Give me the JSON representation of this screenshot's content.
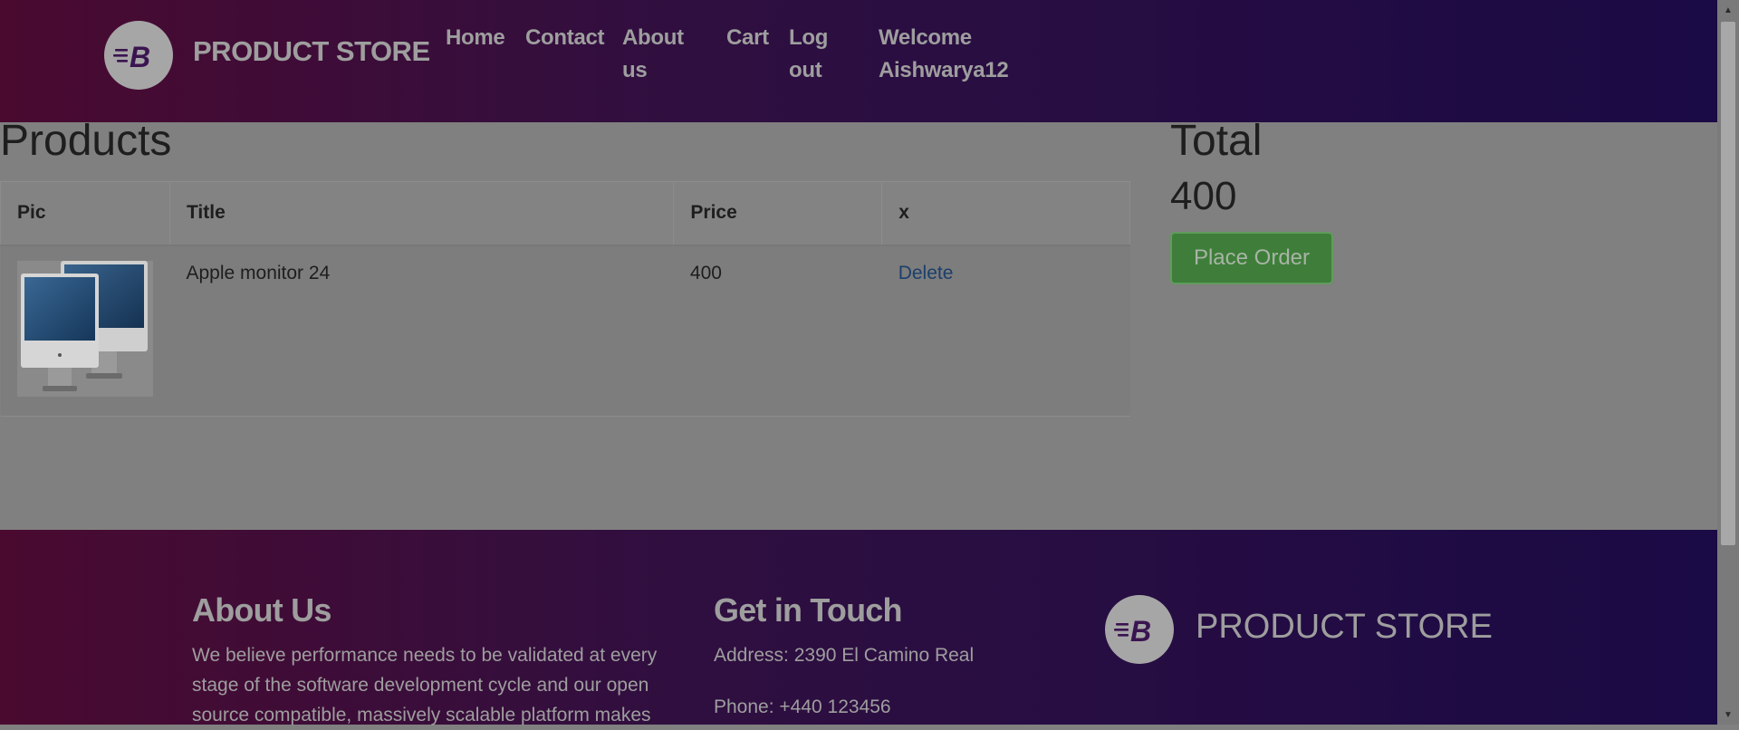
{
  "nav": {
    "brand": "PRODUCT STORE",
    "links": {
      "home": "Home",
      "contact": "Contact",
      "about_line1": "About",
      "about_line2": "us",
      "cart": "Cart",
      "logout_line1": "Log",
      "logout_line2": "out",
      "welcome_line1": "Welcome",
      "welcome_line2": "Aishwarya12"
    }
  },
  "cart": {
    "heading": "Products",
    "columns": [
      "Pic",
      "Title",
      "Price",
      "x"
    ],
    "rows": [
      {
        "title": "Apple monitor 24",
        "price": "400",
        "action": "Delete"
      }
    ]
  },
  "summary": {
    "heading": "Total",
    "total": "400",
    "place_order_label": "Place Order"
  },
  "footer": {
    "about_heading": "About Us",
    "about_line1": "We believe performance needs to be validated at every",
    "about_line2": "stage of the software development cycle and our open",
    "about_line3": "source compatible, massively scalable platform makes",
    "contact_heading": "Get in Touch",
    "address": "Address: 2390 El Camino Real",
    "phone": "Phone: +440 123456",
    "brand": "PRODUCT STORE"
  },
  "colors": {
    "header_gradient_start": "#4a0a30",
    "header_gradient_end": "#1a0a45",
    "place_order_bg": "#3e7e3a",
    "delete_link": "#1a3f6b"
  }
}
